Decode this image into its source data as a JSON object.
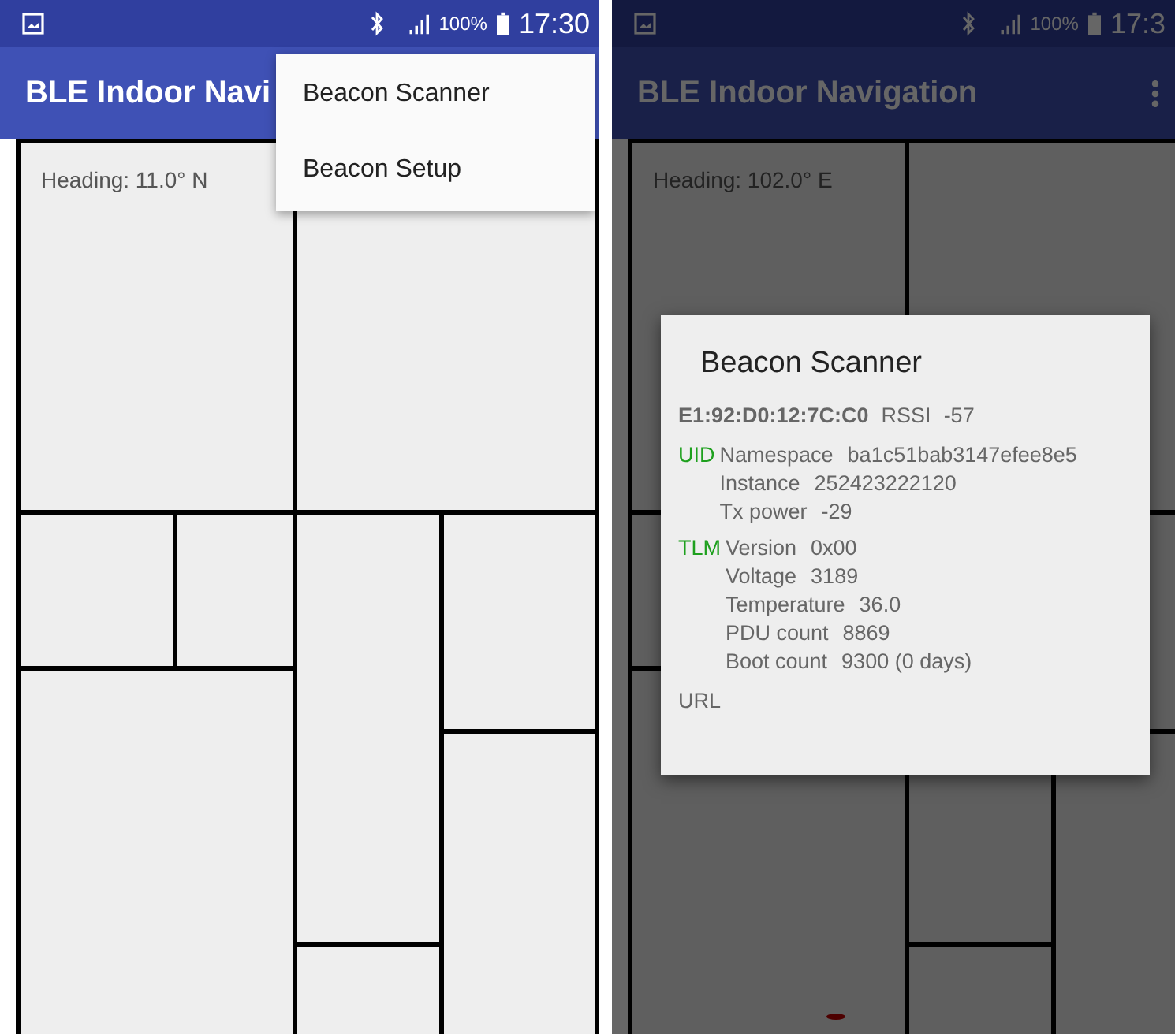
{
  "phones": [
    {
      "status_bar": {
        "battery": "100%",
        "time": "17:30"
      },
      "app_bar": {
        "title": "BLE Indoor Navi"
      },
      "heading": "Heading: 11.0° N",
      "menu": {
        "items": [
          "Beacon Scanner",
          "Beacon Setup"
        ]
      }
    },
    {
      "status_bar": {
        "battery": "100%",
        "time": "17:3"
      },
      "app_bar": {
        "title": "BLE Indoor Navigation"
      },
      "heading": "Heading: 102.0° E",
      "dialog": {
        "title": "Beacon Scanner",
        "address": "E1:92:D0:12:7C:C0",
        "rssi_label": "RSSI",
        "rssi": "-57",
        "sections": [
          {
            "tag": "UID",
            "rows": [
              {
                "label": "Namespace",
                "value": "ba1c51bab3147efee8e5"
              },
              {
                "label": "Instance",
                "value": "252423222120"
              },
              {
                "label": "Tx power",
                "value": "-29"
              }
            ]
          },
          {
            "tag": "TLM",
            "rows": [
              {
                "label": "Version",
                "value": "0x00"
              },
              {
                "label": "Voltage",
                "value": "3189"
              },
              {
                "label": "Temperature",
                "value": "36.0"
              },
              {
                "label": "PDU count",
                "value": "8869"
              },
              {
                "label": "Boot count",
                "value": "9300 (0 days)"
              }
            ]
          }
        ],
        "footer": "URL"
      }
    }
  ]
}
